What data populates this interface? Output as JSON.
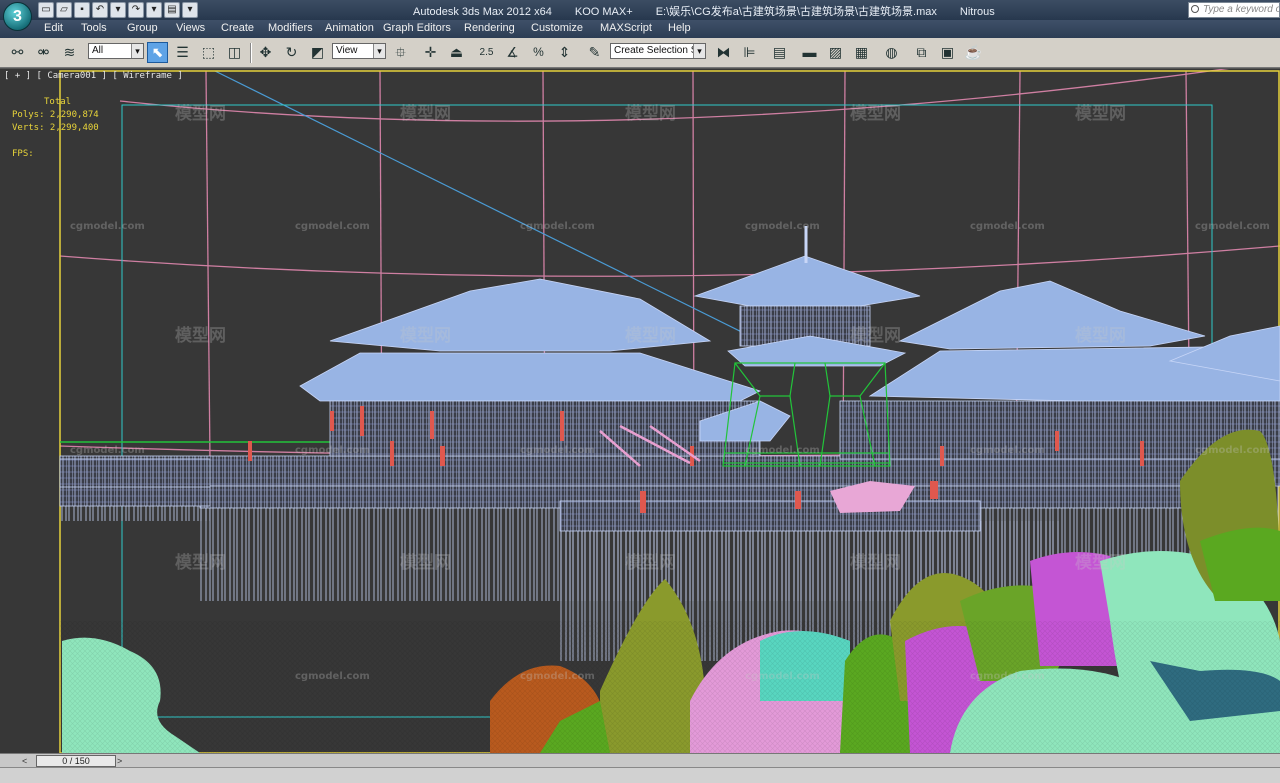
{
  "app": {
    "logo": "3"
  },
  "title": {
    "app_name": "Autodesk 3ds Max  2012 x64",
    "plugin": "KOO MAX+",
    "file_path": "E:\\娱乐\\CG发布a\\古建筑场景\\古建筑场景\\古建筑场景.max",
    "renderer": "Nitrous"
  },
  "search": {
    "placeholder": "Type a keyword or"
  },
  "quick_access": [
    "new-icon",
    "open-icon",
    "save-icon",
    "undo-icon",
    "redo-icon",
    "project-icon"
  ],
  "menu": [
    "Edit",
    "Tools",
    "Group",
    "Views",
    "Create",
    "Modifiers",
    "Animation",
    "Graph Editors",
    "Rendering",
    "Customize",
    "MAXScript",
    "Help"
  ],
  "toolbar": {
    "filter_value": "All",
    "coord_value": "View",
    "snap_value": "2.5",
    "angle_value": "%",
    "selection_set_placeholder": "Create Selection Se"
  },
  "viewport": {
    "label": "[ + ] [ Camera001 ] [ Wireframe ]",
    "stats_total": "Total",
    "stats_polys": "Polys: 2,290,874",
    "stats_verts": "Verts: 2,299,400",
    "stats_fps": "FPS:"
  },
  "watermarks": {
    "logo_text": "模型网",
    "url_text": "cgmodel.com"
  },
  "timeline": {
    "frame": "0 / 150",
    "prev": "<",
    "next": ">"
  },
  "colors": {
    "roof": "#98b4e4",
    "wire_green": "#22c43a",
    "tree_magenta": "#c455d4",
    "tree_mint": "#8fe6bc",
    "tree_olive": "#8a9a2c",
    "tree_pink": "#e39ad8",
    "tree_orange": "#b85a1e",
    "tree_lime": "#5aa820",
    "safe_frame": "#2fc8c8",
    "viewport_border": "#e6d23c"
  }
}
